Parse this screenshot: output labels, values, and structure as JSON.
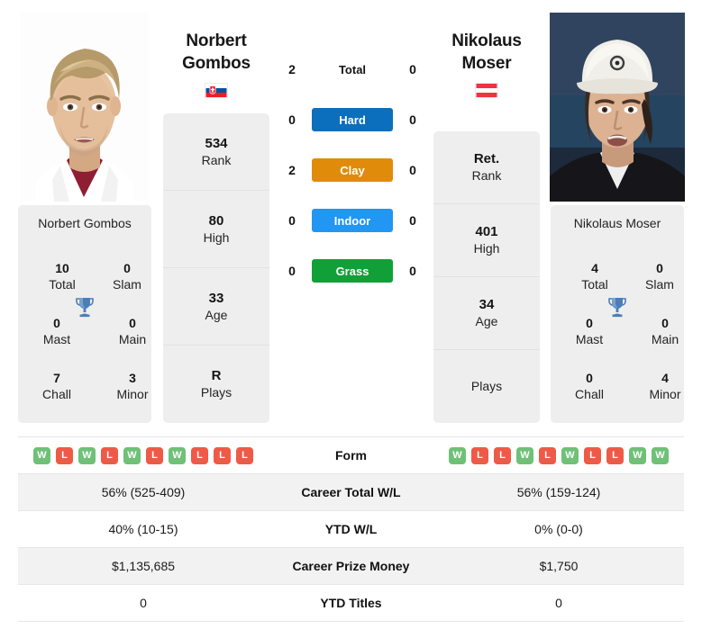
{
  "players": {
    "left": {
      "name_line1": "Norbert",
      "name_line2": "Gombos",
      "full_name": "Norbert Gombos",
      "flag_country": "Slovakia",
      "flag_code": "svk",
      "photo_alt": "Norbert Gombos headshot",
      "info": [
        {
          "value": "534",
          "label": "Rank"
        },
        {
          "value": "80",
          "label": "High"
        },
        {
          "value": "33",
          "label": "Age"
        },
        {
          "value": "R",
          "label": "Plays"
        }
      ],
      "titles": {
        "heading": "Norbert Gombos",
        "total": "10",
        "total_label": "Total",
        "slam": "0",
        "slam_label": "Slam",
        "mast": "0",
        "mast_label": "Mast",
        "main": "0",
        "main_label": "Main",
        "chall": "7",
        "chall_label": "Chall",
        "minor": "3",
        "minor_label": "Minor"
      },
      "form": [
        "W",
        "L",
        "W",
        "L",
        "W",
        "L",
        "W",
        "L",
        "L",
        "L"
      ],
      "career_total_wl": "56% (525-409)",
      "ytd_wl": "40% (10-15)",
      "career_prize_money": "$1,135,685",
      "ytd_titles": "0"
    },
    "right": {
      "name_line1": "Nikolaus",
      "name_line2": "Moser",
      "full_name": "Nikolaus Moser",
      "flag_country": "Austria",
      "flag_code": "aut",
      "photo_alt": "Nikolaus Moser headshot",
      "info": [
        {
          "value": "Ret.",
          "label": "Rank"
        },
        {
          "value": "401",
          "label": "High"
        },
        {
          "value": "34",
          "label": "Age"
        },
        {
          "value": "",
          "label": "Plays"
        }
      ],
      "titles": {
        "heading": "Nikolaus Moser",
        "total": "4",
        "total_label": "Total",
        "slam": "0",
        "slam_label": "Slam",
        "mast": "0",
        "mast_label": "Mast",
        "main": "0",
        "main_label": "Main",
        "chall": "0",
        "chall_label": "Chall",
        "minor": "4",
        "minor_label": "Minor"
      },
      "form": [
        "W",
        "L",
        "L",
        "W",
        "L",
        "W",
        "L",
        "L",
        "W",
        "W"
      ],
      "career_total_wl": "56% (159-124)",
      "ytd_wl": "0% (0-0)",
      "career_prize_money": "$1,750",
      "ytd_titles": "0"
    }
  },
  "head_to_head": [
    {
      "label": "Total",
      "left": "2",
      "right": "0",
      "color": ""
    },
    {
      "label": "Hard",
      "left": "0",
      "right": "0",
      "color": "#0b6fbd"
    },
    {
      "label": "Clay",
      "left": "2",
      "right": "0",
      "color": "#e08c0a"
    },
    {
      "label": "Indoor",
      "left": "0",
      "right": "0",
      "color": "#2196f3"
    },
    {
      "label": "Grass",
      "left": "0",
      "right": "0",
      "color": "#11a038"
    }
  ],
  "table_rows": [
    {
      "key": "form",
      "label": "Form"
    },
    {
      "key": "career",
      "label": "Career Total W/L"
    },
    {
      "key": "ytd",
      "label": "YTD W/L"
    },
    {
      "key": "prize",
      "label": "Career Prize Money"
    },
    {
      "key": "titles",
      "label": "YTD Titles"
    }
  ],
  "colors": {
    "win": "#6ec177",
    "loss": "#ef5a47",
    "trophy": "#4a7ebb",
    "card_bg": "#eeeeee",
    "row_alt": "#f2f2f2"
  }
}
